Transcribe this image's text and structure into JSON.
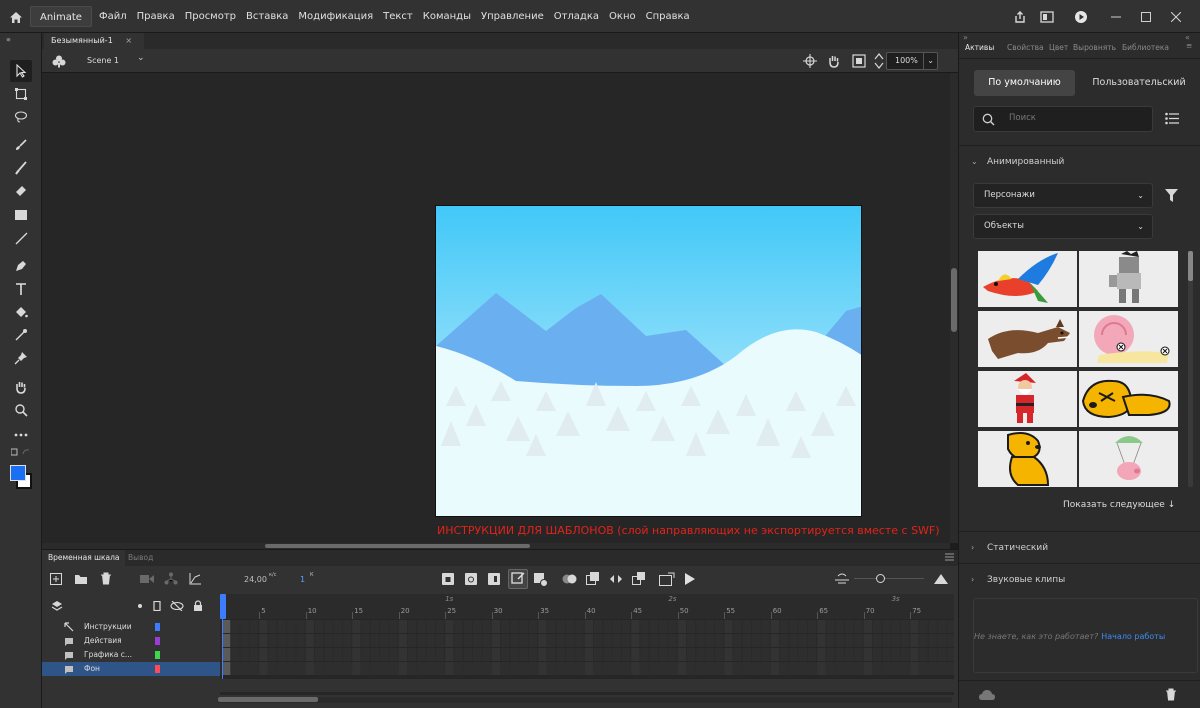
{
  "colors": {
    "accent": "#3d8cf2",
    "instruction": "#e2231a",
    "layer_selected": "#2f5488"
  },
  "menubar": {
    "app_label": "Animate",
    "menus": [
      "Файл",
      "Правка",
      "Просмотр",
      "Вставка",
      "Модификация",
      "Текст",
      "Команды",
      "Управление",
      "Отладка",
      "Окно",
      "Справка"
    ]
  },
  "document": {
    "tab_title": "Безымянный-1",
    "scene_name": "Scene 1",
    "zoom": "100%",
    "instruction": "ИНСТРУКЦИИ ДЛЯ ШАБЛОНОВ (слой направляющих не экспортируется вместе с SWF)"
  },
  "timeline": {
    "tabs": [
      "Временная шкала",
      "Вывод"
    ],
    "fps": "24,00",
    "fps_unit": "к/с",
    "current_frame": "1",
    "frame_unit": "К",
    "ruler_ticks": [
      "5",
      "10",
      "15",
      "20",
      "25",
      "30",
      "35",
      "40",
      "45",
      "50",
      "55",
      "60",
      "65",
      "70",
      "75"
    ],
    "ruler_seconds": [
      "1s",
      "2s",
      "3s"
    ],
    "layers": [
      {
        "name": "Инструкции",
        "color": "#3d7cff",
        "icon": "guide-icon",
        "selected": false
      },
      {
        "name": "Действия",
        "color": "#9a3dd6",
        "icon": "layer-icon",
        "selected": false
      },
      {
        "name": "Графика с...",
        "color": "#3dd64f",
        "icon": "layer-icon",
        "selected": false
      },
      {
        "name": "Фон",
        "color": "#ff4a5a",
        "icon": "layer-icon",
        "selected": true
      }
    ]
  },
  "assets": {
    "tabs": [
      "Активы",
      "Свойства",
      "Цвет",
      "Выровнять",
      "Библиотека"
    ],
    "default_button": "По умолчанию",
    "user_button": "Пользовательский",
    "search_placeholder": "Поиск",
    "section_animated": "Анимированный",
    "dropdown_characters": "Персонажи",
    "dropdown_objects": "Объекты",
    "thumbnails": [
      "parrot",
      "robot-character",
      "wolf",
      "snail",
      "santa",
      "dog-lying",
      "dog-sitting",
      "pig-parachute"
    ],
    "show_next": "Показать следующее ↓",
    "section_static": "Статический",
    "section_sound": "Звуковые клипы",
    "help_question": "Не знаете, как это работает?",
    "help_link": "Начало работы"
  }
}
